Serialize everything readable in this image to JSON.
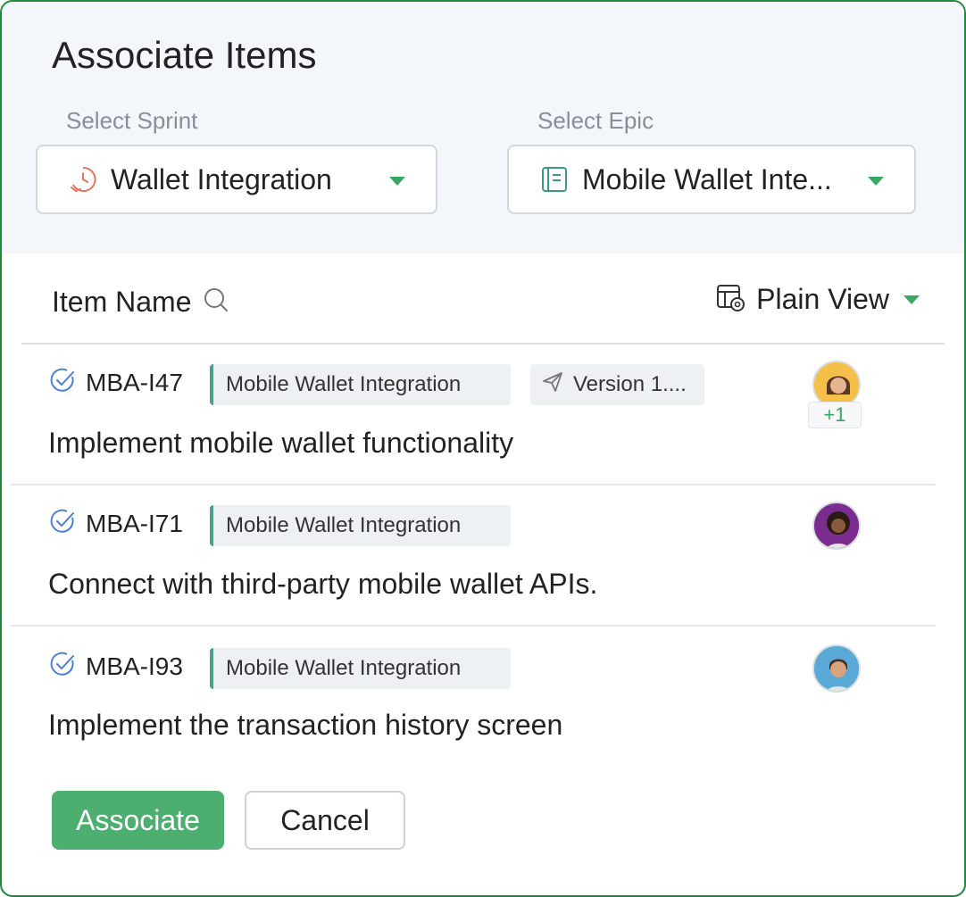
{
  "dialog": {
    "title": "Associate Items",
    "sprint": {
      "label": "Select Sprint",
      "value": "Wallet Integration",
      "icon": "sprint-clock-icon"
    },
    "epic": {
      "label": "Select Epic",
      "value": "Mobile Wallet Inte...",
      "icon": "epic-book-icon"
    }
  },
  "list": {
    "column_label": "Item Name",
    "view_label": "Plain View",
    "rows": [
      {
        "id": "MBA-I47",
        "epic_tag": "Mobile Wallet Integration",
        "release_tag": "Version 1....",
        "title": "Implement mobile wallet functionality",
        "extra_assignees": "+1"
      },
      {
        "id": "MBA-I71",
        "epic_tag": "Mobile Wallet Integration",
        "title": "Connect with third-party mobile wallet APIs."
      },
      {
        "id": "MBA-I93",
        "epic_tag": "Mobile Wallet Integration",
        "title": "Implement the transaction history screen"
      }
    ]
  },
  "actions": {
    "associate": "Associate",
    "cancel": "Cancel"
  },
  "colors": {
    "accent": "#4caf6f",
    "border": "#1f8a3b",
    "caret": "#3aa864",
    "check": "#4a7fd4"
  }
}
